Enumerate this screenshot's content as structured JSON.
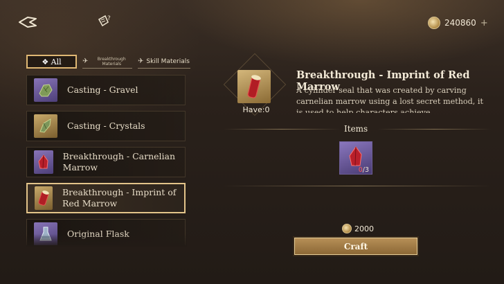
{
  "header": {
    "back_icon": "back-arrow-icon",
    "help_icon": "help-icon",
    "currency": {
      "icon": "coin-icon",
      "amount": "240860",
      "add_label": "+"
    }
  },
  "filters": [
    {
      "label": "❖ All",
      "selected": true
    },
    {
      "label": "Breakthrough Materials",
      "selected": false
    },
    {
      "label": "Skill Materials",
      "selected": false
    }
  ],
  "materials": [
    {
      "label": "Casting - Gravel",
      "icon": "gravel-icon",
      "frame": "purple"
    },
    {
      "label": "Casting - Crystals",
      "icon": "crystal-icon",
      "frame": "gold"
    },
    {
      "label": "Breakthrough - Carnelian Marrow",
      "icon": "carnelian-marrow-icon",
      "frame": "purple"
    },
    {
      "label": "Breakthrough - Imprint of Red Marrow",
      "icon": "red-marrow-seal-icon",
      "frame": "gold",
      "selected": true
    },
    {
      "label": "Original Flask",
      "icon": "flask-icon",
      "frame": "purple"
    }
  ],
  "detail": {
    "title": "Breakthrough - Imprint of Red Marrow",
    "description": "A cylinder seal that was created by carving carnelian marrow using a lost secret method, it is used to help characters achieve breakthroughs.",
    "have": "Have:0",
    "items_label": "Items",
    "required_item": {
      "icon": "carnelian-marrow-icon",
      "have": "0",
      "need": "/3"
    },
    "cost": "2000",
    "craft_label": "Craft"
  },
  "colors": {
    "accent_gold": "#e3c48a",
    "rare_purple": "#6a58a0",
    "insufficient_red": "#ff5a55"
  }
}
